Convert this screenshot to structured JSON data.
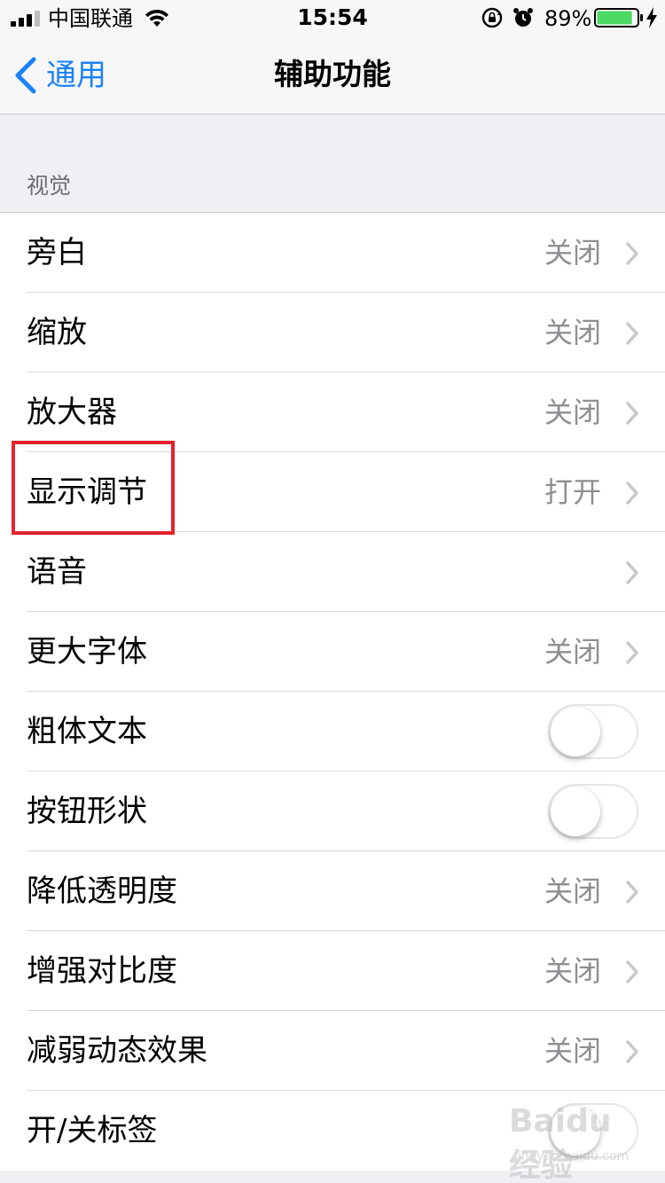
{
  "status_bar": {
    "carrier": "中国联通",
    "time": "15:54",
    "battery_percent": "89%",
    "battery_level": 0.89,
    "battery_color": "#4cd964"
  },
  "nav": {
    "back_label": "通用",
    "title": "辅助功能",
    "accent_color": "#1a82fb"
  },
  "section": {
    "header": "视觉"
  },
  "rows": [
    {
      "label": "旁白",
      "value": "关闭",
      "kind": "disclosure"
    },
    {
      "label": "缩放",
      "value": "关闭",
      "kind": "disclosure"
    },
    {
      "label": "放大器",
      "value": "关闭",
      "kind": "disclosure"
    },
    {
      "label": "显示调节",
      "value": "打开",
      "kind": "disclosure"
    },
    {
      "label": "语音",
      "value": "",
      "kind": "disclosure"
    },
    {
      "label": "更大字体",
      "value": "关闭",
      "kind": "disclosure"
    },
    {
      "label": "粗体文本",
      "value": "",
      "kind": "toggle",
      "on": false
    },
    {
      "label": "按钮形状",
      "value": "",
      "kind": "toggle",
      "on": false
    },
    {
      "label": "降低透明度",
      "value": "关闭",
      "kind": "disclosure"
    },
    {
      "label": "增强对比度",
      "value": "关闭",
      "kind": "disclosure"
    },
    {
      "label": "减弱动态效果",
      "value": "关闭",
      "kind": "disclosure"
    },
    {
      "label": "开/关标签",
      "value": "",
      "kind": "toggle",
      "on": false
    }
  ],
  "highlight": {
    "target": "显示调节",
    "color": "#e2232a"
  },
  "watermark": {
    "text": "Baidu经验",
    "sub": "jingyan.baidu.com"
  }
}
